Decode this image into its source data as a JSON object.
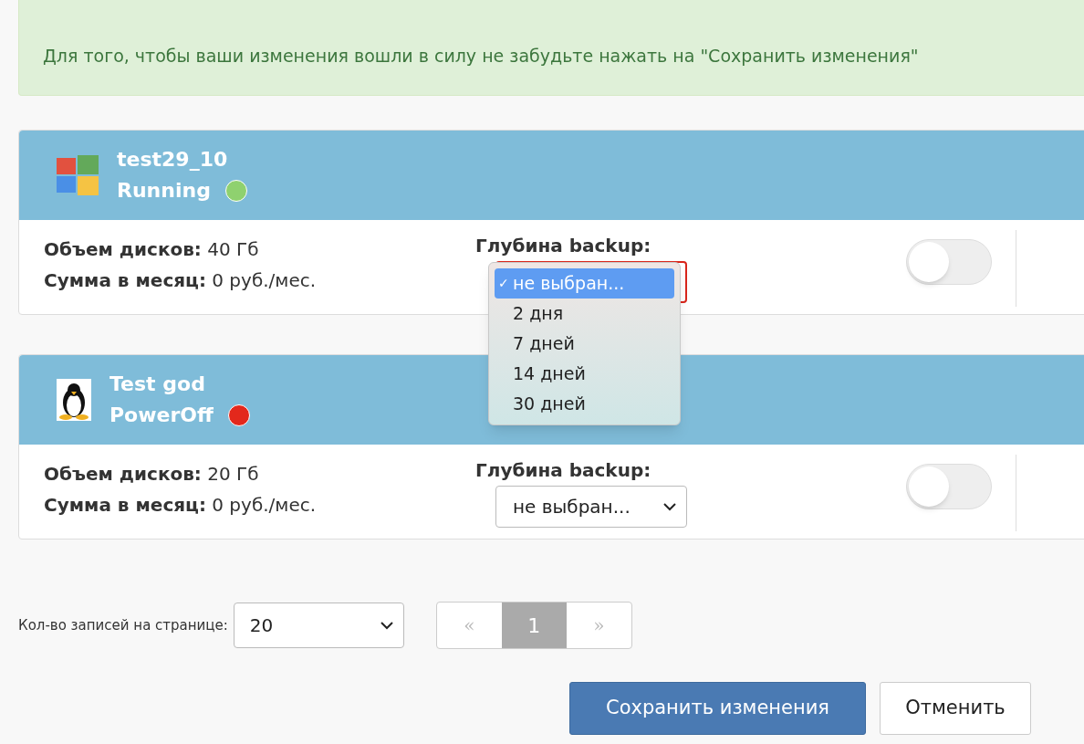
{
  "notice": "Для того, чтобы ваши изменения вошли в силу не забудьте нажать на \"Сохранить изменения\"",
  "servers": [
    {
      "kind": "windows",
      "name": "test29_10",
      "status": "Running",
      "color": "#8fd16f",
      "disk_label": "Объем дисков:",
      "disk_value": "40 Гб",
      "sum_label": "Сумма в месяц:",
      "sum_value": "0 руб./мес.",
      "backup_label": "Глубина backup:",
      "backup": {
        "open": true,
        "check_mark": "✓",
        "options": [
          {
            "label": "не выбран...",
            "selected": true
          },
          {
            "label": "2 дня",
            "selected": false
          },
          {
            "label": "7 дней",
            "selected": false
          },
          {
            "label": "14 дней",
            "selected": false
          },
          {
            "label": "30 дней",
            "selected": false
          }
        ]
      },
      "on": false
    },
    {
      "kind": "linux",
      "name": "Test god",
      "status": "PowerOff",
      "color": "#e3281c",
      "disk_label": "Объем дисков:",
      "disk_value": "20 Гб",
      "sum_label": "Сумма в месяц:",
      "sum_value": "0 руб./мес.",
      "backup_label": "Глубина backup:",
      "backup": {
        "open": false,
        "value": "не выбран..."
      },
      "on": false
    }
  ],
  "per_page": {
    "label": "Кол-во записей на странице:",
    "value": "20"
  },
  "pager": [
    {
      "label": "«",
      "kind": "prev",
      "selected": false
    },
    {
      "label": "1",
      "kind": "page",
      "selected": true
    },
    {
      "label": "»",
      "kind": "next",
      "selected": false
    }
  ],
  "buttons": [
    {
      "label": "Сохранить изменения",
      "kind": "primary"
    },
    {
      "label": "Отменить",
      "kind": "secondary"
    }
  ]
}
